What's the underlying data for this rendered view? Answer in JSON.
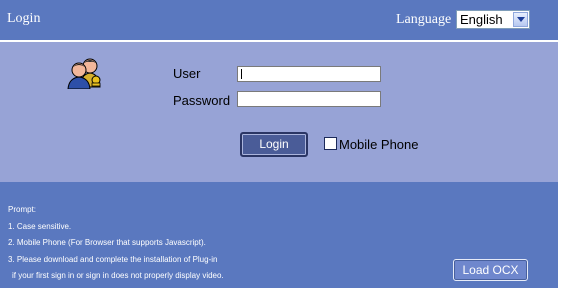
{
  "header": {
    "title": "Login",
    "language_label": "Language",
    "language_selected": "English"
  },
  "form": {
    "user_label": "User",
    "user_value": "",
    "password_label": "Password",
    "password_value": "",
    "login_button": "Login",
    "mobile_phone_label": "Mobile Phone",
    "mobile_phone_checked": false
  },
  "prompt": {
    "lines": [
      "Prompt:",
      "1. Case sensitive.",
      "2. Mobile Phone (For Browser that supports Javascript).",
      "3. Please download and complete the installation of Plug-in",
      " if your first sign in or sign in does not properly display video."
    ],
    "load_button": "Load OCX"
  },
  "colors": {
    "header_bg": "#5a78bf",
    "form_bg": "#97a3d6",
    "button_bg": "#4a5c98"
  },
  "icons": [
    "users-icon",
    "chevron-down-icon",
    "checkbox-icon"
  ]
}
